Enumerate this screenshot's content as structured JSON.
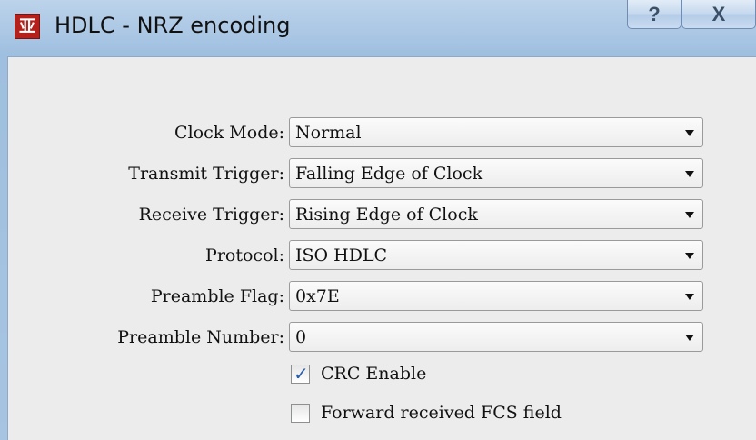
{
  "window": {
    "title": "HDLC - NRZ encoding",
    "app_icon_glyph": "亚",
    "help_label": "?",
    "close_label": "X",
    "accent_color": "#b5201b"
  },
  "form": {
    "clock_mode": {
      "label": "Clock Mode:",
      "value": "Normal"
    },
    "transmit_trigger": {
      "label": "Transmit Trigger:",
      "value": "Falling Edge of Clock"
    },
    "receive_trigger": {
      "label": "Receive Trigger:",
      "value": "Rising Edge of Clock"
    },
    "protocol": {
      "label": "Protocol:",
      "value": "ISO HDLC"
    },
    "preamble_flag": {
      "label": "Preamble Flag:",
      "value": "0x7E"
    },
    "preamble_number": {
      "label": "Preamble Number:",
      "value": "0"
    },
    "crc_enable": {
      "label": "CRC Enable",
      "checked": true,
      "mark": "✓"
    },
    "forward_fcs": {
      "label": "Forward received FCS field",
      "checked": false
    }
  }
}
